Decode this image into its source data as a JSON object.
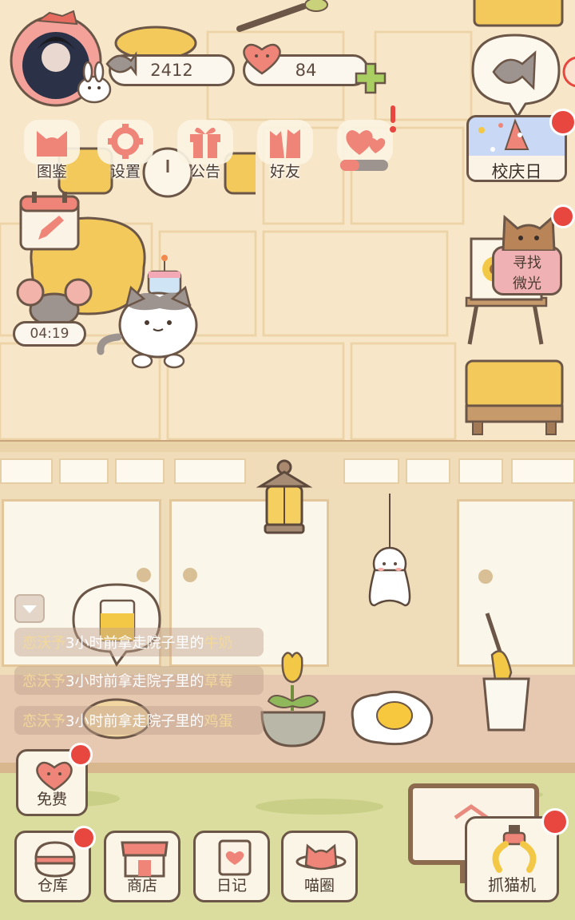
{
  "status": {
    "fish_count": "2412",
    "heart_count": "84",
    "timer": "04:19"
  },
  "menu": [
    {
      "label": "图鉴",
      "icon": "cat-head-icon"
    },
    {
      "label": "设置",
      "icon": "gear-icon"
    },
    {
      "label": "公告",
      "icon": "gift-icon"
    },
    {
      "label": "好友",
      "icon": "friends-icon"
    }
  ],
  "events": {
    "anniversary_label": "校庆日",
    "glimmer_line1": "寻找",
    "glimmer_line2": "微光"
  },
  "logs": [
    {
      "who": "恋沃予",
      "mid": "3小时前拿走院子里的",
      "item": "牛奶"
    },
    {
      "who": "恋沃予",
      "mid": "3小时前拿走院子里的",
      "item": "草莓"
    },
    {
      "who": "恋沃予",
      "mid": "3小时前拿走院子里的",
      "item": "鸡蛋"
    }
  ],
  "buttons": {
    "free": "免费",
    "warehouse": "仓库",
    "shop": "商店",
    "diary": "日记",
    "circle": "喵圈",
    "claw": "抓猫机"
  },
  "colors": {
    "background": "#f6e6c6",
    "outline": "#6b5647",
    "badge_red": "#e8473f",
    "accent_pink": "#f08a80",
    "grass": "#d9dd9c"
  }
}
